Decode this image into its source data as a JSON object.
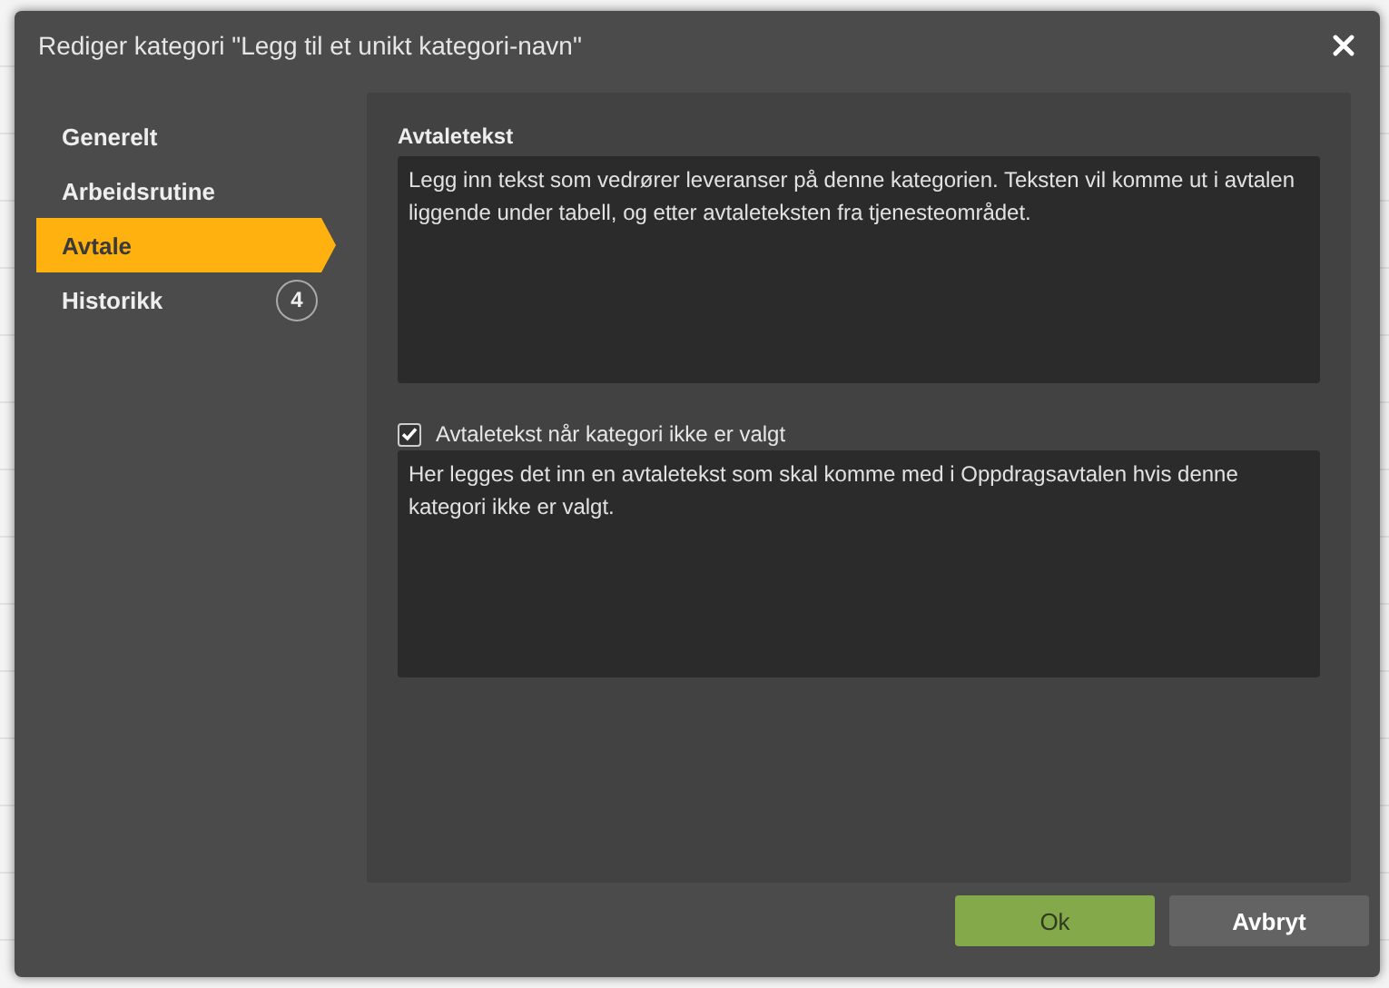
{
  "dialog": {
    "title": "Rediger kategori \"Legg til et unikt kategori-navn\""
  },
  "sidebar": {
    "items": [
      {
        "label": "Generelt",
        "selected": false
      },
      {
        "label": "Arbeidsrutine",
        "selected": false
      },
      {
        "label": "Avtale",
        "selected": true
      },
      {
        "label": "Historikk",
        "selected": false,
        "badge": "4"
      }
    ]
  },
  "content": {
    "agreement_label": "Avtaletekst",
    "agreement_text": "Legg inn tekst som vedrører leveranser på denne kategorien. Teksten vil komme ut i avtalen liggende under tabell, og etter avtaleteksten fra tjenesteområdet.",
    "fallback_checkbox": {
      "label": "Avtaletekst når kategori ikke er valgt",
      "checked": true
    },
    "fallback_text": "Her legges det inn en avtaletekst som skal komme med i Oppdragsavtalen hvis denne kategori ikke er valgt."
  },
  "buttons": [
    {
      "label": "Ok",
      "kind": "primary"
    },
    {
      "label": "Avbryt",
      "kind": "secondary"
    }
  ]
}
